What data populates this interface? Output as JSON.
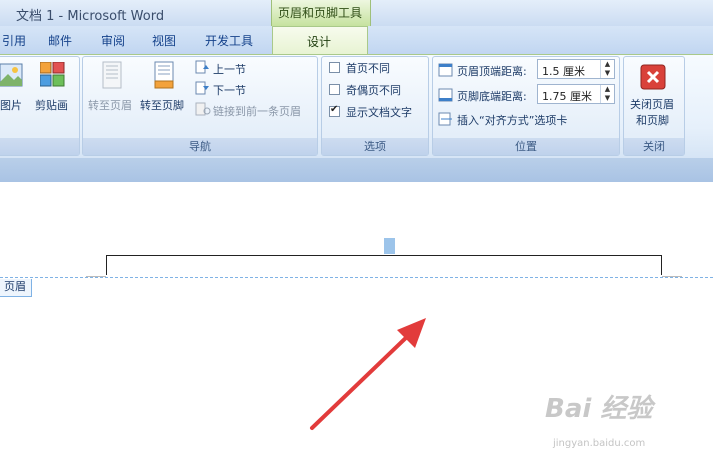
{
  "window": {
    "title": "文档 1 - Microsoft Word",
    "contextual_tool": "页眉和页脚工具"
  },
  "tabs": [
    "引用",
    "邮件",
    "审阅",
    "视图",
    "开发工具"
  ],
  "active_tab": "设计",
  "ribbon": {
    "insert": {
      "picture": "图片",
      "clipart": "剪贴画"
    },
    "nav": {
      "label": "导航",
      "goto_header": "转至页眉",
      "goto_footer": "转至页脚",
      "prev": "上一节",
      "next": "下一节",
      "link_prev": "链接到前一条页眉"
    },
    "options": {
      "label": "选项",
      "first_page": "首页不同",
      "odd_even": "奇偶页不同",
      "show_doc_text": "显示文档文字"
    },
    "position": {
      "label": "位置",
      "header_top_label": "页眉顶端距离:",
      "header_top_value": "1.5 厘米",
      "footer_bottom_label": "页脚底端距离:",
      "footer_bottom_value": "1.75 厘米",
      "insert_align": "插入“对齐方式”选项卡"
    },
    "close": {
      "label": "关闭",
      "close_line1": "关闭页眉",
      "close_line2": "和页脚"
    }
  },
  "document": {
    "header_tag": "页眉"
  },
  "watermark": {
    "brand": "Bai 经验",
    "url": "jingyan.baidu.com"
  }
}
